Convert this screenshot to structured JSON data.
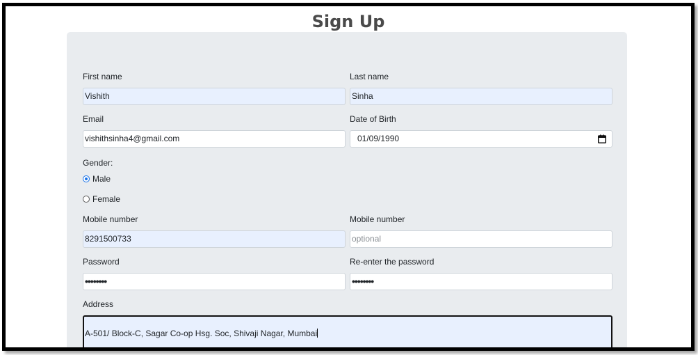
{
  "page": {
    "title": "Sign Up"
  },
  "form": {
    "first_name": {
      "label": "First name",
      "value": "Vishith"
    },
    "last_name": {
      "label": "Last name",
      "value": "Sinha"
    },
    "email": {
      "label": "Email",
      "value": "vishithsinha4@gmail.com"
    },
    "dob": {
      "label": "Date of Birth",
      "value": "01/09/1990",
      "icon": "calendar-icon"
    },
    "gender": {
      "label": "Gender:",
      "options": [
        {
          "label": "Male",
          "checked": true
        },
        {
          "label": "Female",
          "checked": false
        }
      ]
    },
    "mobile1": {
      "label": "Mobile number",
      "value": "8291500733"
    },
    "mobile2": {
      "label": "Mobile number",
      "placeholder": "optional",
      "value": ""
    },
    "password": {
      "label": "Password",
      "value": "••••••••"
    },
    "password_confirm": {
      "label": "Re-enter the password",
      "value": "••••••••"
    },
    "address": {
      "label": "Address",
      "value": "A-501/ Block-C, Sagar Co-op Hsg. Soc, Shivaji Nagar, Mumbai"
    }
  },
  "colors": {
    "card_bg": "#e9ecef",
    "autofill_bg": "#e8f0fe",
    "radio_accent": "#1a73e8"
  }
}
